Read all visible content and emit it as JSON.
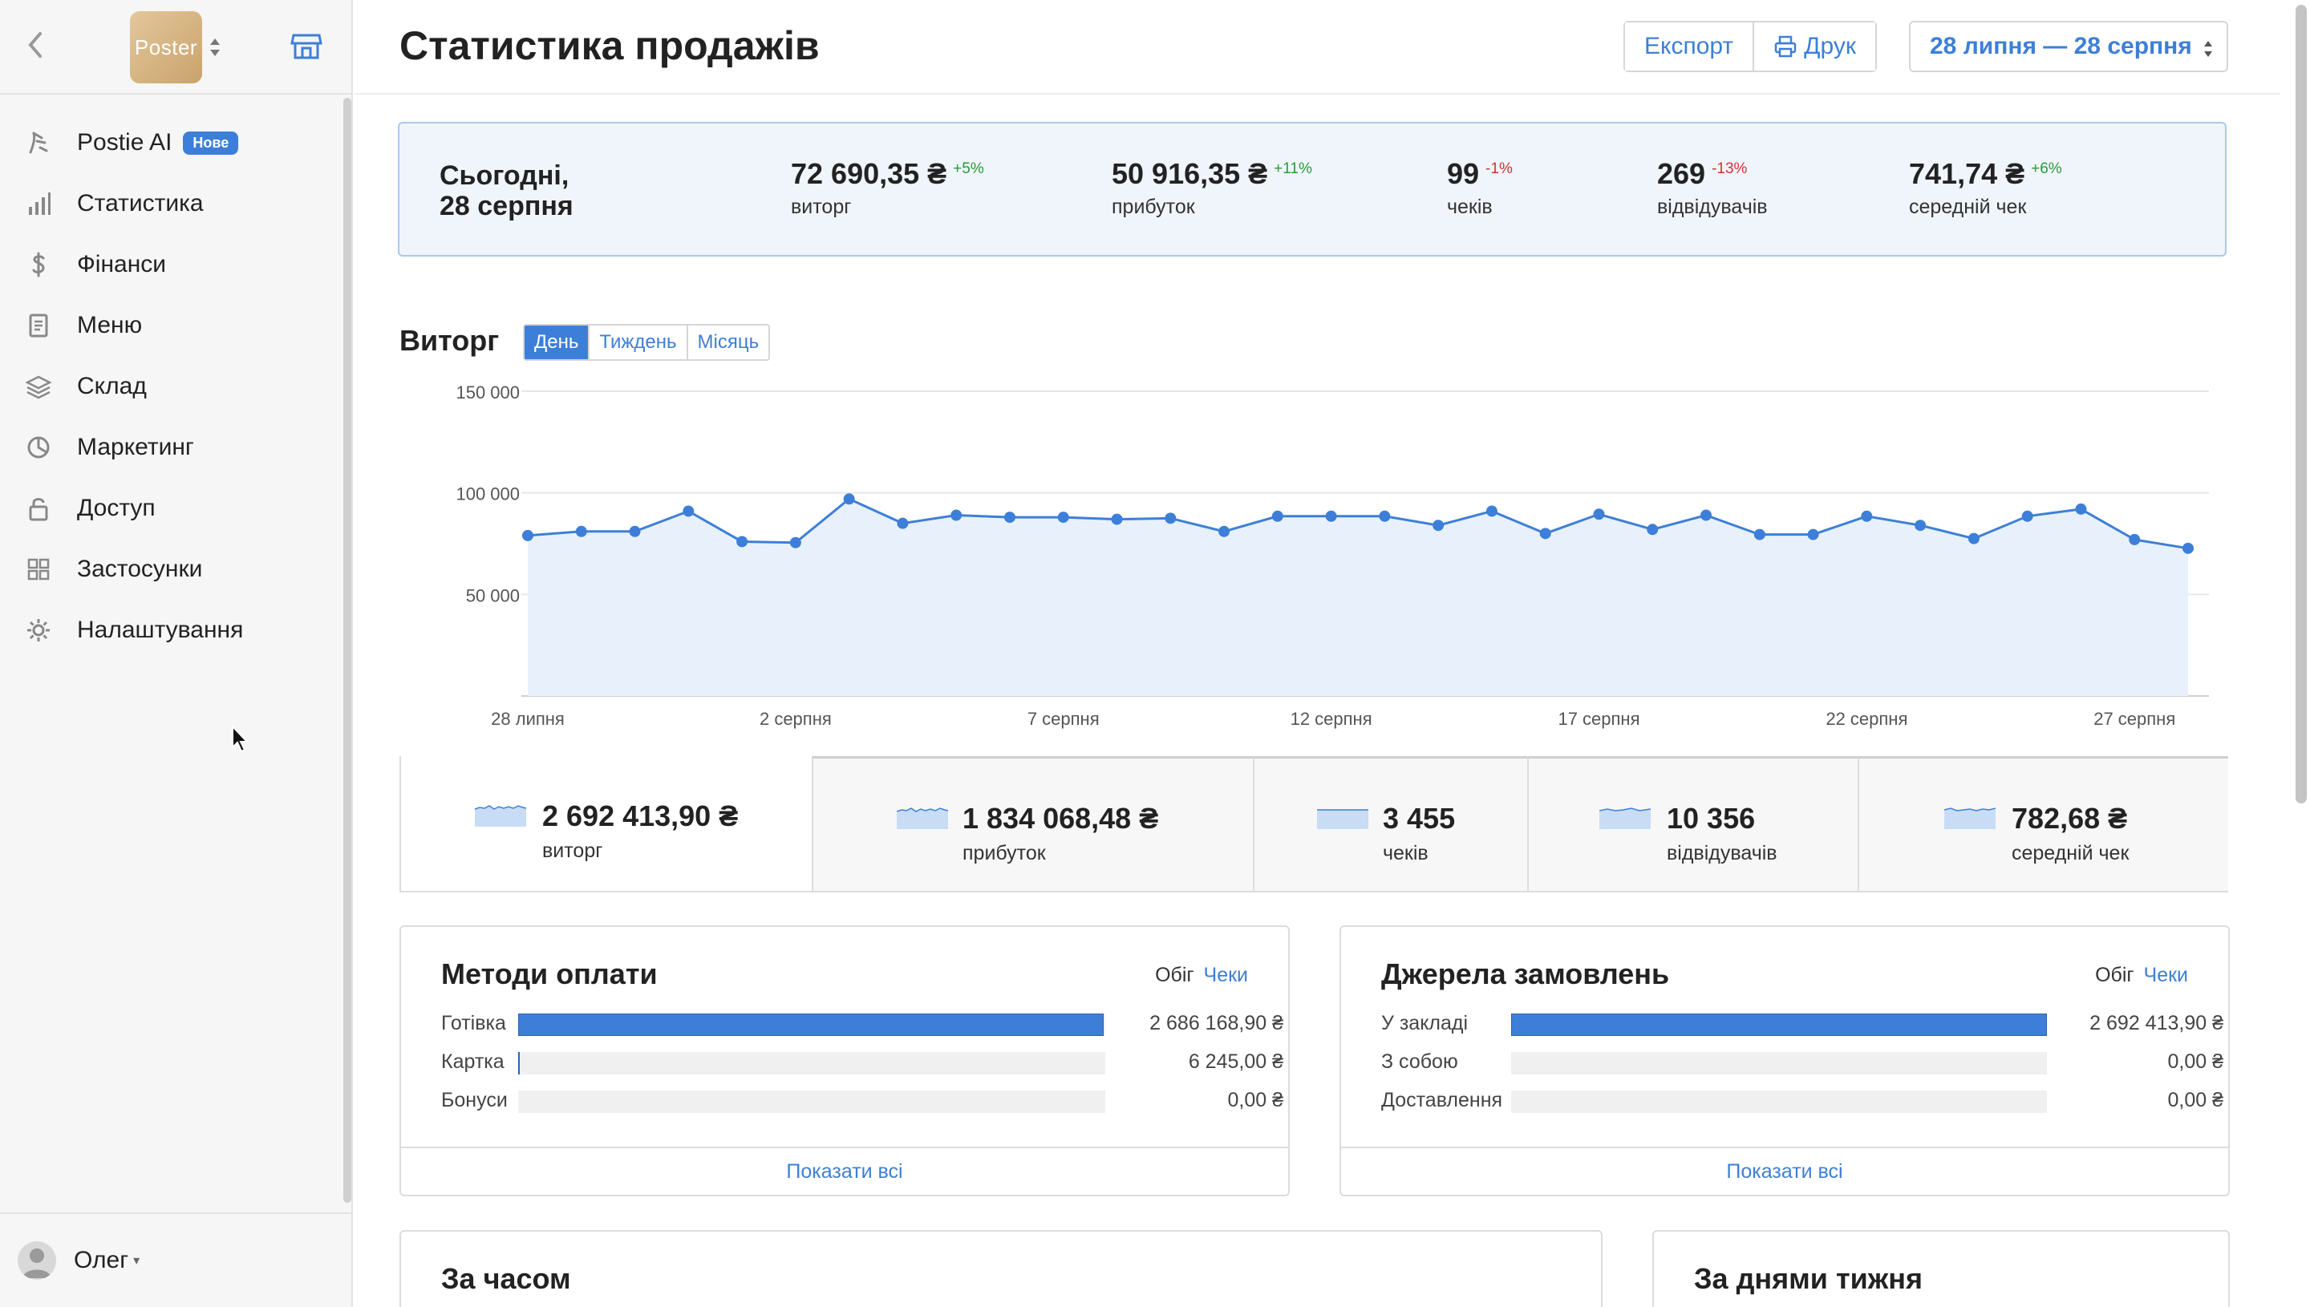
{
  "sidebar": {
    "logo_text": "Poster",
    "items": [
      {
        "label": "Postie AI",
        "icon": "postie-ai-icon",
        "badge": "Нове"
      },
      {
        "label": "Статистика",
        "icon": "bar-chart-icon"
      },
      {
        "label": "Фінанси",
        "icon": "dollar-icon"
      },
      {
        "label": "Меню",
        "icon": "document-icon"
      },
      {
        "label": "Склад",
        "icon": "layers-icon"
      },
      {
        "label": "Маркетинг",
        "icon": "pie-chart-icon"
      },
      {
        "label": "Доступ",
        "icon": "lock-icon"
      },
      {
        "label": "Застосунки",
        "icon": "apps-grid-icon"
      },
      {
        "label": "Налаштування",
        "icon": "gear-icon"
      }
    ],
    "user_name": "Олег"
  },
  "header": {
    "title": "Статистика продажів",
    "export_label": "Експорт",
    "print_label": "Друк",
    "date_range": "28 липня — 28 серпня"
  },
  "today": {
    "date_line1": "Сьогодні,",
    "date_line2": "28 серпня",
    "kpis": [
      {
        "value": "72 690,35 ₴",
        "delta": "+5%",
        "label": "виторг",
        "trend": "up"
      },
      {
        "value": "50 916,35 ₴",
        "delta": "+11%",
        "label": "прибуток",
        "trend": "up"
      },
      {
        "value": "99",
        "delta": "-1%",
        "label": "чеків",
        "trend": "down"
      },
      {
        "value": "269",
        "delta": "-13%",
        "label": "відвідувачів",
        "trend": "down"
      },
      {
        "value": "741,74 ₴",
        "delta": "+6%",
        "label": "середній чек",
        "trend": "up"
      }
    ]
  },
  "revenue": {
    "title": "Виторг",
    "periods": [
      "День",
      "Тиждень",
      "Місяць"
    ],
    "active_period": "День"
  },
  "chart_data": {
    "type": "area",
    "x": [
      "28 липня",
      "29 липня",
      "30 липня",
      "31 липня",
      "1 серпня",
      "2 серпня",
      "3 серпня",
      "4 серпня",
      "5 серпня",
      "6 серпня",
      "7 серпня",
      "8 серпня",
      "9 серпня",
      "10 серпня",
      "11 серпня",
      "12 серпня",
      "13 серпня",
      "14 серпня",
      "15 серпня",
      "16 серпня",
      "17 серпня",
      "18 серпня",
      "19 серпня",
      "20 серпня",
      "21 серпня",
      "22 серпня",
      "23 серпня",
      "24 серпня",
      "25 серпня",
      "26 серпня",
      "27 серпня",
      "28 серпня"
    ],
    "x_ticks": [
      "28 липня",
      "2 серпня",
      "7 серпня",
      "12 серпня",
      "17 серпня",
      "22 серпня",
      "27 серпня"
    ],
    "y_ticks": [
      "150 000",
      "100 000",
      "50 000"
    ],
    "y_tick_values": [
      150000,
      100000,
      50000
    ],
    "ylim": [
      0,
      150000
    ],
    "series": [
      {
        "values": [
          79000,
          81000,
          81000,
          91000,
          76000,
          75500,
          97000,
          85000,
          89000,
          88000,
          88000,
          87000,
          87500,
          81000,
          88500,
          88500,
          88500,
          84000,
          91000,
          80000,
          89500,
          82000,
          89000,
          79500,
          79500,
          88500,
          84000,
          77500,
          88500,
          92000,
          77000,
          72700
        ],
        "color": "#3d7fd8",
        "fill": "#e8f1fb"
      }
    ],
    "grid": true
  },
  "totals": [
    {
      "value": "2 692 413,90 ₴",
      "label": "виторг"
    },
    {
      "value": "1 834 068,48 ₴",
      "label": "прибуток"
    },
    {
      "value": "3 455",
      "label": "чеків"
    },
    {
      "value": "10 356",
      "label": "відвідувачів"
    },
    {
      "value": "782,68 ₴",
      "label": "середній чек"
    }
  ],
  "payment_methods": {
    "title": "Методи оплати",
    "toggle_a": "Обіг",
    "toggle_b": "Чеки",
    "rows": [
      {
        "label": "Готівка",
        "value": "2 686 168,90 ₴",
        "share": 0.9977
      },
      {
        "label": "Картка",
        "value": "6 245,00 ₴",
        "share": 0.0023
      },
      {
        "label": "Бонуси",
        "value": "0,00 ₴",
        "share": 0
      }
    ],
    "show_all": "Показати всі"
  },
  "order_sources": {
    "title": "Джерела замовлень",
    "toggle_a": "Обіг",
    "toggle_b": "Чеки",
    "rows": [
      {
        "label": "У закладі",
        "value": "2 692 413,90 ₴",
        "share": 1
      },
      {
        "label": "З собою",
        "value": "0,00 ₴",
        "share": 0
      },
      {
        "label": "Доставлення",
        "value": "0,00 ₴",
        "share": 0
      }
    ],
    "show_all": "Показати всі"
  },
  "by_time": {
    "title": "За часом"
  },
  "by_weekday": {
    "title": "За днями тижня"
  }
}
